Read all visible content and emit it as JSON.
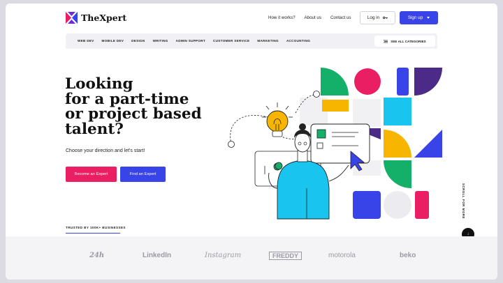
{
  "brand": {
    "name": "TheXpert"
  },
  "nav": {
    "links": [
      "How it works?",
      "About us",
      "Contact us"
    ],
    "login_label": "Log in",
    "signup_label": "Sign up"
  },
  "categories": {
    "items": [
      "WEB DEV",
      "MOBILE DEV",
      "DESIGN",
      "WRITING",
      "ADMIN SUPPORT",
      "CUSTOMER SERVICE",
      "MARKETING",
      "ACCOUNTING"
    ],
    "see_all_label": "SEE ALL CATEGORIES"
  },
  "hero": {
    "title_lines": [
      "Looking",
      "for a part-time",
      "or project based",
      "talent?"
    ],
    "subtitle": "Choose your direction and let's start!",
    "primary_cta": "Become an Expert",
    "secondary_cta": "Find an Expert"
  },
  "trusted": {
    "label": "TRUSTED BY 100K+ BUSINESSES"
  },
  "side": {
    "scroll_label": "SCROLL FOR MORE"
  },
  "logos": [
    "24h",
    "LinkedIn",
    "Instagram",
    "FREDDY",
    "motorola",
    "beko"
  ],
  "colors": {
    "accent_blue": "#3843e8",
    "accent_pink": "#ea1e63",
    "green": "#14b06a",
    "cyan": "#19c5ee",
    "yellow": "#f7b500",
    "purple": "#4b2a88"
  }
}
